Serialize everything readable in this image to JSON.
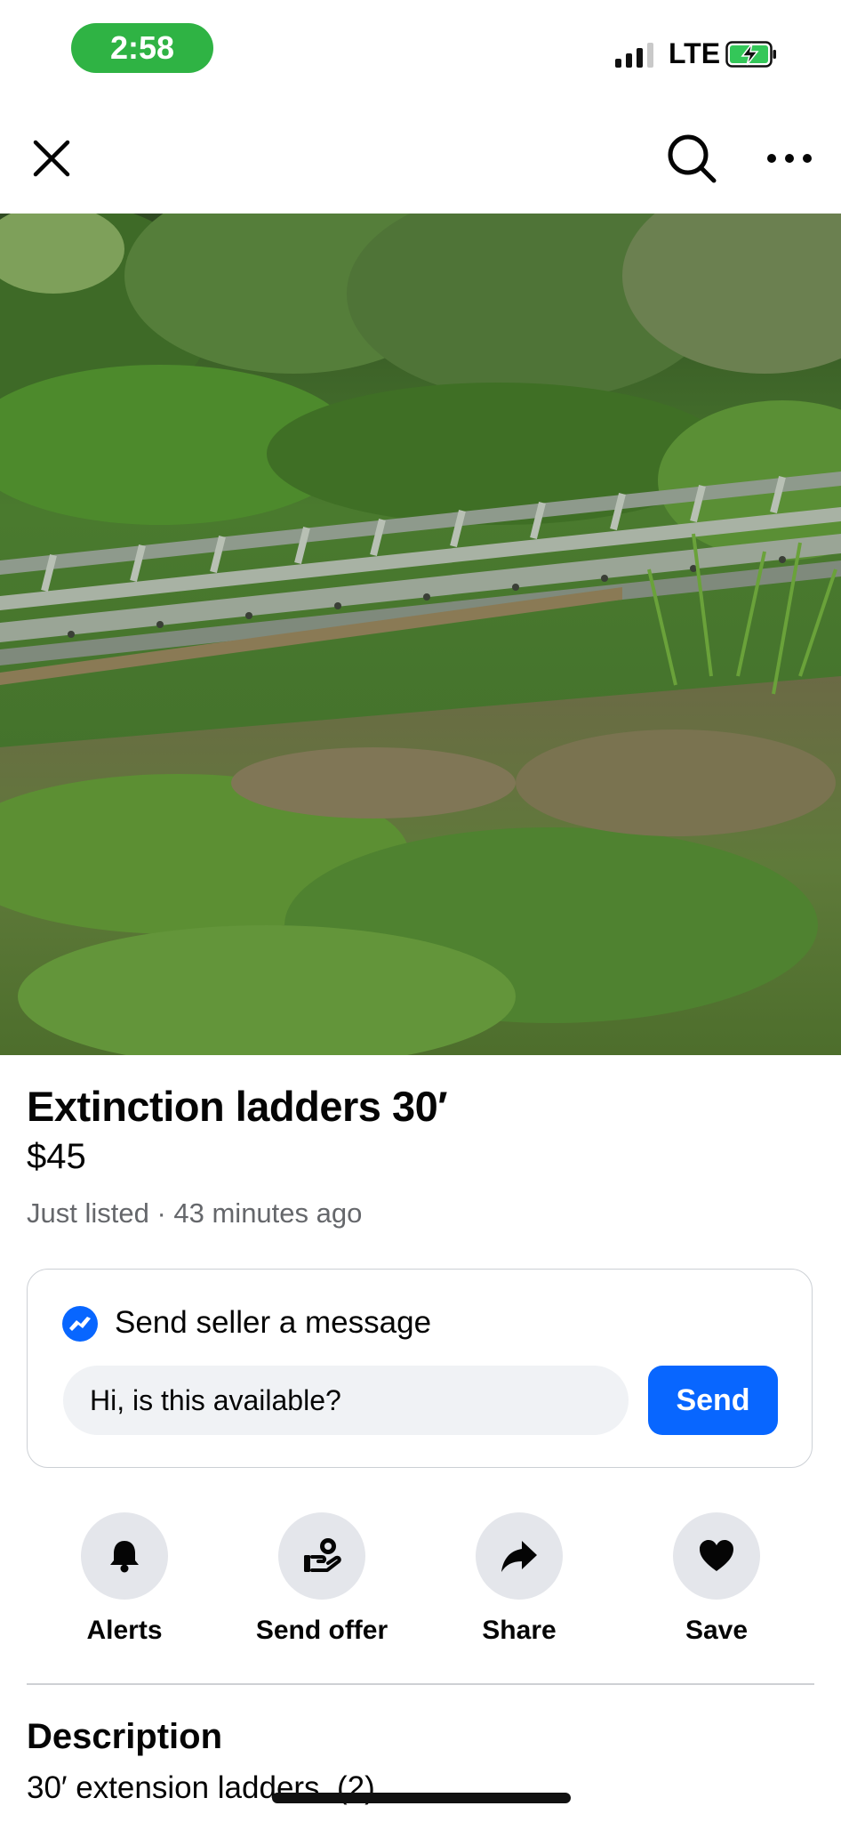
{
  "status_bar": {
    "time": "2:58",
    "network": "LTE"
  },
  "listing": {
    "title": "Extinction ladders 30′",
    "price": "$45",
    "meta": "Just listed · 43 minutes ago"
  },
  "message": {
    "heading": "Send seller a message",
    "input_value": "Hi, is this available?",
    "send_label": "Send"
  },
  "actions": [
    {
      "label": "Alerts",
      "icon": "bell-icon"
    },
    {
      "label": "Send offer",
      "icon": "send-offer-icon"
    },
    {
      "label": "Share",
      "icon": "share-icon"
    },
    {
      "label": "Save",
      "icon": "heart-icon"
    }
  ],
  "description": {
    "heading": "Description",
    "text": "30′ extension ladders. (2)"
  },
  "colors": {
    "accent": "#0866ff",
    "time_pill": "#2fb344"
  }
}
